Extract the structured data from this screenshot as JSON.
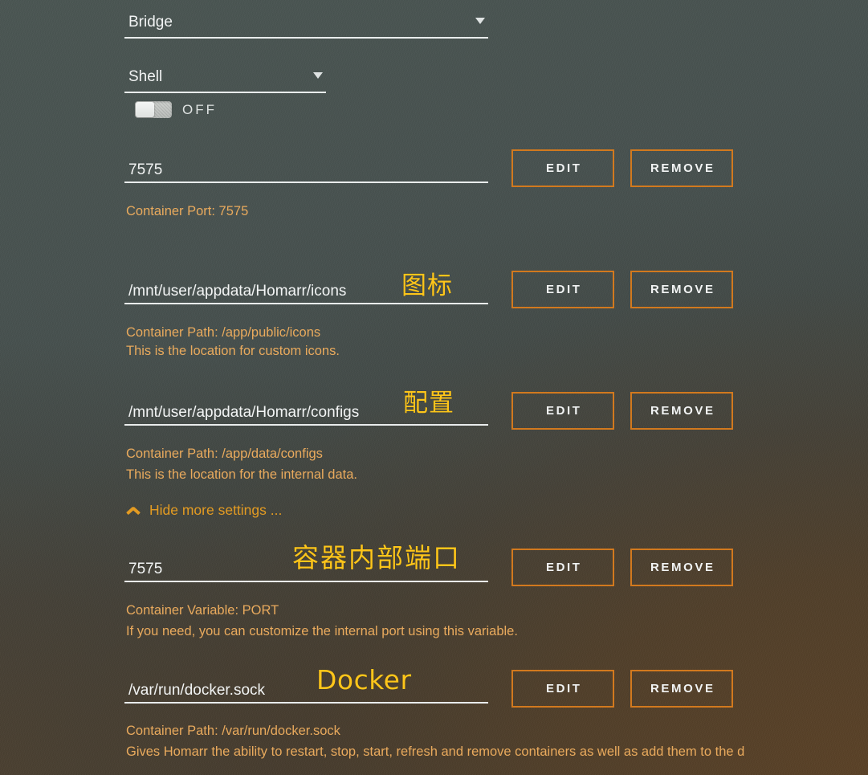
{
  "theme": {
    "accent_orange": "#d2791e",
    "helper_orange": "#e9aa5d",
    "annotation_yellow": "#fdc51a",
    "link_orange": "#e39b22",
    "text_white": "#f2f4f4",
    "bg_top_left": "#4a5552",
    "bg_top_right": "#3d4846",
    "bg_bottom_left": "#4a4033",
    "bg_bottom_right": "#4a3b2d"
  },
  "network_type": {
    "label": "Bridge",
    "caret": "chevron-down-icon"
  },
  "console_shell": {
    "label": "Shell",
    "caret": "chevron-down-icon"
  },
  "privileged_toggle": {
    "state_label": "OFF",
    "checked": false
  },
  "buttons": {
    "edit": "EDIT",
    "remove": "REMOVE"
  },
  "collapse": {
    "label": "Hide more settings ...",
    "icon": "chevron-up-icon"
  },
  "entries": [
    {
      "id": "port-7575",
      "value": "7575",
      "annotation": "",
      "helper_lines": [
        "Container Port: 7575"
      ]
    },
    {
      "id": "path-icons",
      "value": "/mnt/user/appdata/Homarr/icons",
      "annotation": "图标",
      "helper_lines": [
        "Container Path: /app/public/icons",
        "This is the location for custom icons."
      ]
    },
    {
      "id": "path-configs",
      "value": "/mnt/user/appdata/Homarr/configs",
      "annotation": "配置",
      "helper_lines": [
        "Container Path: /app/data/configs",
        "This is the location for the internal data."
      ]
    },
    {
      "id": "variable-port",
      "value": "7575",
      "annotation": "容器内部端口",
      "helper_lines": [
        "Container Variable: PORT",
        "If you need, you can customize the internal port using this variable."
      ]
    },
    {
      "id": "path-docker-sock",
      "value": "/var/run/docker.sock",
      "annotation": "Docker",
      "helper_lines": [
        "Container Path: /var/run/docker.sock",
        "Gives Homarr the ability to restart, stop, start, refresh and remove containers as well as add them to the d"
      ]
    }
  ]
}
